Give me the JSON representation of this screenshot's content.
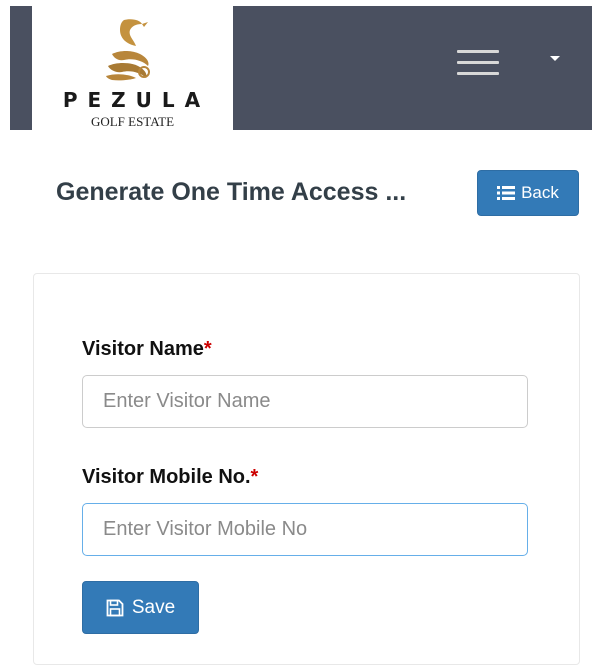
{
  "header": {
    "logo_text": "PEZULA",
    "logo_subtext": "GOLF ESTATE",
    "menu_icon": "hamburger-icon",
    "dropdown_icon": "caret-down-icon"
  },
  "page": {
    "title": "Generate One Time Access ...",
    "back_label": "Back",
    "back_icon": "list-icon"
  },
  "form": {
    "visitor_name": {
      "label": "Visitor Name",
      "required_mark": "*",
      "placeholder": "Enter Visitor Name",
      "value": ""
    },
    "visitor_mobile": {
      "label": "Visitor Mobile No.",
      "required_mark": "*",
      "placeholder": "Enter Visitor Mobile No",
      "value": ""
    },
    "save_label": "Save",
    "save_icon": "floppy-disk-icon"
  },
  "colors": {
    "navbar": "#4a5060",
    "primary_button": "#337ab7",
    "logo_gold": "#b8863b",
    "required": "#cc0000"
  }
}
